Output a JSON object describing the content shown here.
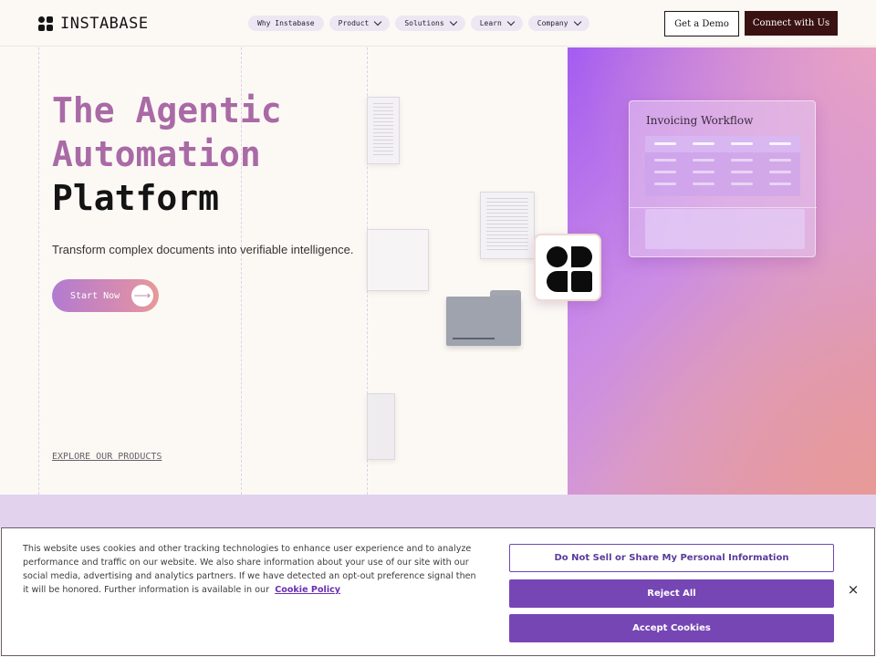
{
  "header": {
    "logo_text": "INSTABASE",
    "nav": [
      {
        "label": "Why Instabase",
        "has_dropdown": false
      },
      {
        "label": "Product",
        "has_dropdown": true
      },
      {
        "label": "Solutions",
        "has_dropdown": true
      },
      {
        "label": "Learn",
        "has_dropdown": true
      },
      {
        "label": "Company",
        "has_dropdown": true
      }
    ],
    "demo_button": "Get a Demo",
    "connect_button": "Connect with Us"
  },
  "hero": {
    "title_line1": "The Agentic",
    "title_line2": "Automation",
    "title_line3": "Platform",
    "subtitle": "Transform complex documents into verifiable intelligence.",
    "cta_label": "Start Now",
    "cta_icon": "arrow-right-icon",
    "explore_link": "EXPLORE OUR PRODUCTS"
  },
  "workflow_card": {
    "title": "Invoicing Workflow"
  },
  "cookie_banner": {
    "text": "This website uses cookies and other tracking technologies to enhance user experience and to analyze performance and traffic on our website. We also share information about your use of our site with our social media, advertising and analytics partners. If we have detected an opt-out preference signal then it will be honored. Further information is available in our",
    "policy_link": "Cookie Policy",
    "do_not_sell": "Do Not Sell or Share My Personal Information",
    "reject_all": "Reject All",
    "accept": "Accept Cookies",
    "close_symbol": "×"
  },
  "colors": {
    "accent_purple": "#7646b4",
    "title_mauve": "#a96aa6",
    "connect_bg": "#3a1212"
  }
}
